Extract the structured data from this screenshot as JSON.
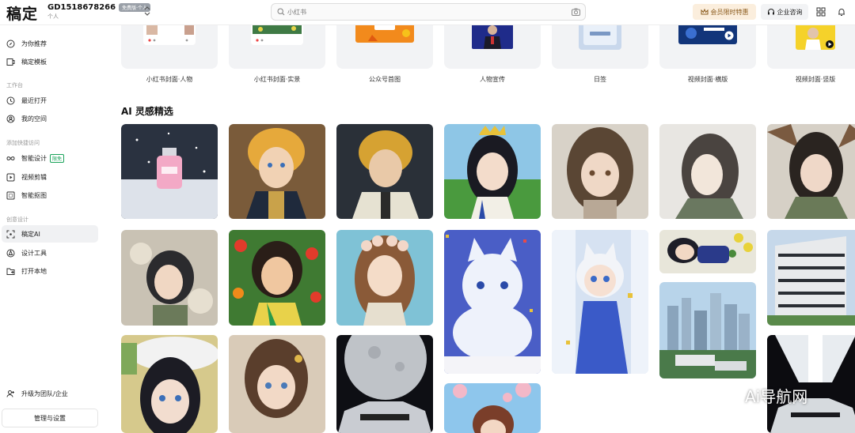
{
  "app": {
    "logo": "稿定",
    "account_id": "GD1518678266",
    "account_badge": "免费版·个人",
    "account_type": "个人"
  },
  "search": {
    "placeholder": "小红书"
  },
  "header": {
    "vip_label": "会员限时特惠",
    "enterprise_label": "企业咨询"
  },
  "sidebar": {
    "top_items": [
      {
        "label": "为你推荐",
        "icon": "compass-icon"
      },
      {
        "label": "稿定模板",
        "icon": "template-icon"
      }
    ],
    "workspace_label": "工作台",
    "workspace_items": [
      {
        "label": "最近打开",
        "icon": "clock-icon"
      },
      {
        "label": "我的空间",
        "icon": "user-circle-icon"
      }
    ],
    "quick_label": "添加快捷访问",
    "quick_items": [
      {
        "label": "智能设计",
        "icon": "infinity-icon",
        "tag": "限免"
      },
      {
        "label": "视频剪辑",
        "icon": "video-icon"
      },
      {
        "label": "智能抠图",
        "icon": "cutout-icon"
      }
    ],
    "create_label": "创意设计",
    "create_items": [
      {
        "label": "稿定AI",
        "icon": "ai-scan-icon",
        "active": true
      },
      {
        "label": "设计工具",
        "icon": "design-tool-icon"
      },
      {
        "label": "打开本地",
        "icon": "folder-icon"
      }
    ],
    "upgrade_label": "升级为团队/企业",
    "manage_label": "管理与设置"
  },
  "templates": [
    "小红书封面·人物",
    "小红书封面·实景",
    "公众号首图",
    "人物宣传",
    "日签",
    "视频封面·横版",
    "视频封面·竖版"
  ],
  "ai_section": {
    "title": "AI 灵感精选"
  },
  "gallery": [
    {
      "col": 0,
      "subject": "perfume-bottle-snow"
    },
    {
      "col": 0,
      "subject": "anime-girl-flower-petals"
    },
    {
      "col": 0,
      "subject": "anime-girl-white-hat"
    },
    {
      "col": 1,
      "subject": "anime-boy-blonde-armor"
    },
    {
      "col": 1,
      "subject": "anime-girl-flowers-colorful"
    },
    {
      "col": 1,
      "subject": "anime-girl-brown-hair-flower"
    },
    {
      "col": 2,
      "subject": "anime-boy-blonde-dark"
    },
    {
      "col": 2,
      "subject": "anime-girl-flower-crown"
    },
    {
      "col": 2,
      "subject": "moon-sports-car"
    },
    {
      "col": 3,
      "subject": "anime-girl-crown-garden"
    },
    {
      "col": 3,
      "subject": "white-wolf-confetti"
    },
    {
      "col": 3,
      "subject": "anime-girl-sakura"
    },
    {
      "col": 4,
      "subject": "girl-brown-hair-portrait"
    },
    {
      "col": 4,
      "subject": "anime-girl-white-fox"
    },
    {
      "col": 5,
      "subject": "girl-sketch-portrait"
    },
    {
      "col": 5,
      "subject": "boy-sleeping-flowers"
    },
    {
      "col": 5,
      "subject": "city-skyline-buildings"
    },
    {
      "col": 6,
      "subject": "girl-tree-portrait"
    },
    {
      "col": 6,
      "subject": "modern-building-terraces"
    },
    {
      "col": 6,
      "subject": "white-car-dark"
    }
  ],
  "watermark": {
    "text": "Ai导航网"
  }
}
